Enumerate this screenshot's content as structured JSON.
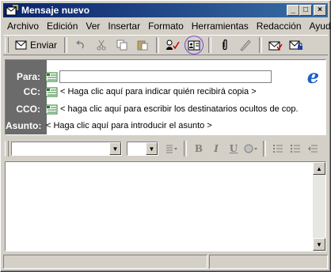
{
  "window": {
    "title": "Mensaje nuevo"
  },
  "title_buttons": {
    "minimize": "_",
    "maximize": "□",
    "close": "×"
  },
  "menu": [
    {
      "label": "Archivo"
    },
    {
      "label": "Edición"
    },
    {
      "label": "Ver"
    },
    {
      "label": "Insertar"
    },
    {
      "label": "Formato"
    },
    {
      "label": "Herramientas"
    },
    {
      "label": "Redacción"
    },
    {
      "label": "Ayuda"
    }
  ],
  "toolbar": {
    "send_label": "Enviar"
  },
  "fields": {
    "to": {
      "label": "Para:",
      "value": ""
    },
    "cc": {
      "label": "CC:",
      "placeholder": "< Haga clic aquí para indicar quién recibirá copia >"
    },
    "bcc": {
      "label": "CCO:",
      "placeholder": "< haga clic aquí para escribir los destinatarios ocultos de cop..."
    },
    "subject": {
      "label": "Asunto:",
      "placeholder": "< Haga clic aquí para introducir el asunto >"
    }
  },
  "format": {
    "bold": "B",
    "italic": "I",
    "underline": "U"
  },
  "colors": {
    "title_start": "#0a246a",
    "title_end": "#3a6ea5",
    "label_panel": "#6b6b6b",
    "highlight_circle": "#7b3fe4"
  }
}
